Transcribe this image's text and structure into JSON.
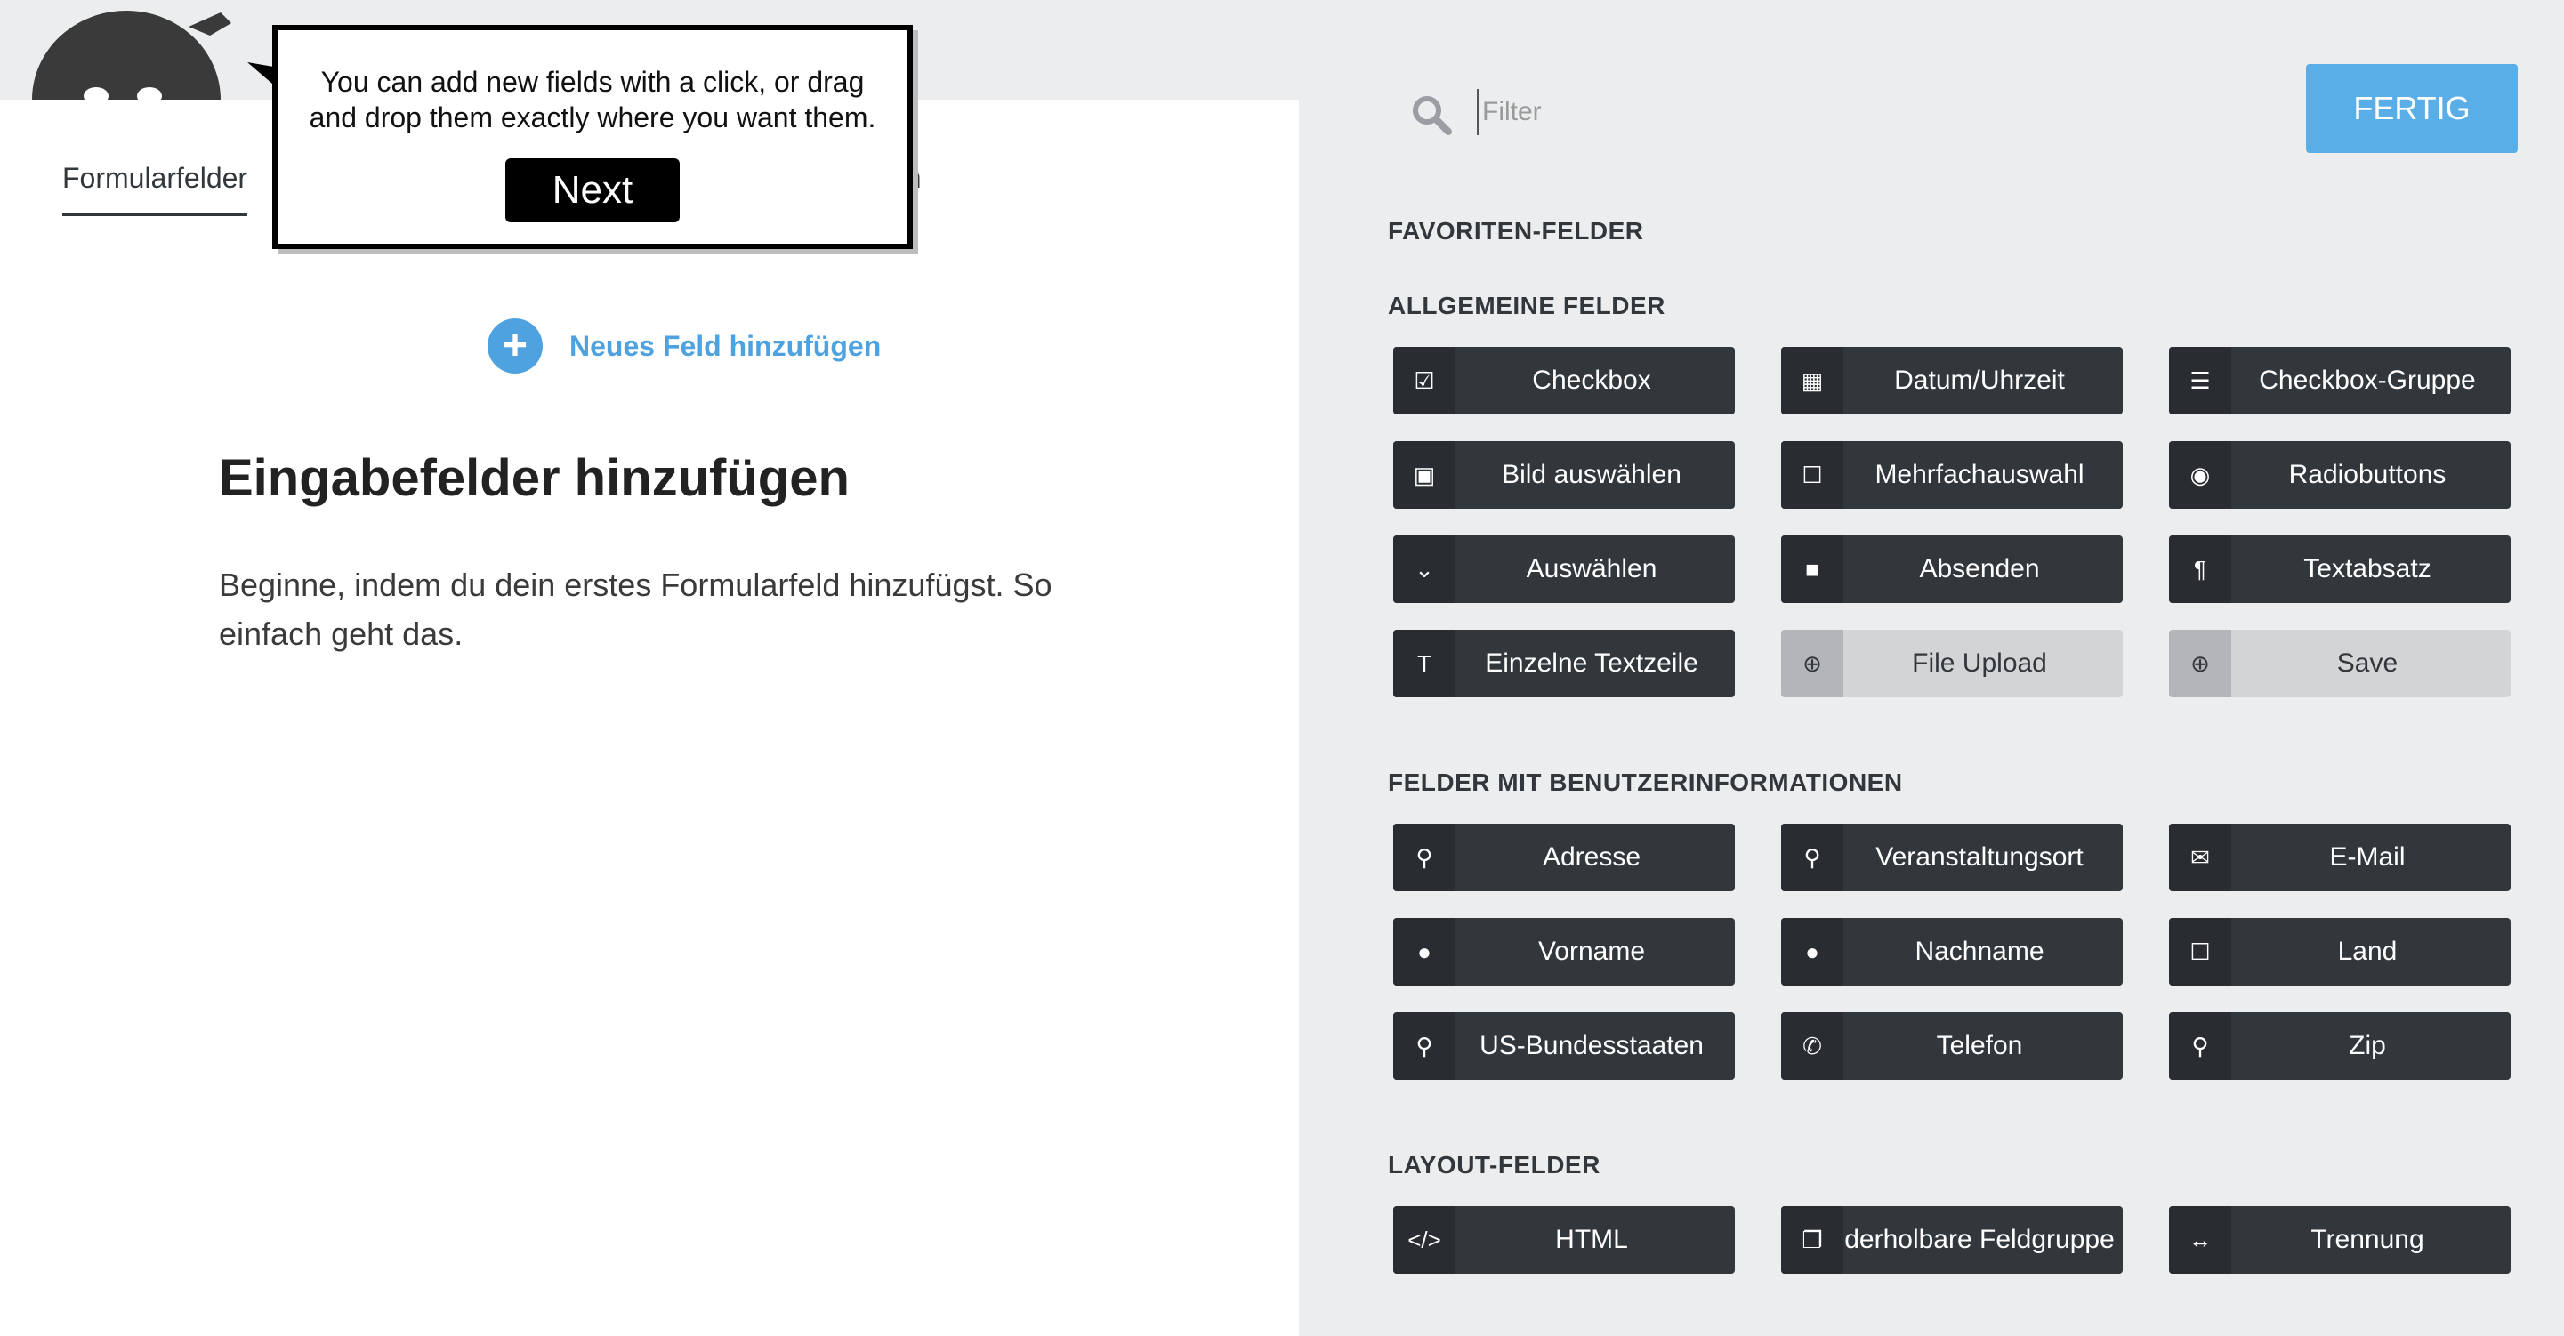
{
  "header": {
    "tabs": [
      {
        "label": "Formularfelder",
        "active": true
      },
      {
        "label": "en",
        "active": false
      }
    ]
  },
  "builder": {
    "add_field_label": "Neues Feld hinzufügen",
    "empty_title": "Eingabefelder hinzufügen",
    "empty_text": "Beginne, indem du dein erstes Formularfeld hinzufügst. So einfach geht das."
  },
  "tooltip": {
    "text": "You can add new fields with a click, or drag and drop them exactly where you want them.",
    "next_label": "Next"
  },
  "sidebar": {
    "filter_placeholder": "Filter",
    "done_label": "FERTIG",
    "sections": [
      {
        "title": "FAVORITEN-FELDER",
        "fields": []
      },
      {
        "title": "ALLGEMEINE FELDER",
        "fields": [
          {
            "label": "Checkbox",
            "icon": "check-square-icon",
            "enabled": true
          },
          {
            "label": "Datum/Uhrzeit",
            "icon": "calendar-icon",
            "enabled": true
          },
          {
            "label": "Checkbox-Gruppe",
            "icon": "list-icon",
            "enabled": true
          },
          {
            "label": "Bild auswählen",
            "icon": "image-icon",
            "enabled": true
          },
          {
            "label": "Mehrfachauswahl",
            "icon": "square-outline-icon",
            "enabled": true
          },
          {
            "label": "Radiobuttons",
            "icon": "radio-icon",
            "enabled": true
          },
          {
            "label": "Auswählen",
            "icon": "chevron-down-icon",
            "enabled": true
          },
          {
            "label": "Absenden",
            "icon": "square-filled-icon",
            "enabled": true
          },
          {
            "label": "Textabsatz",
            "icon": "paragraph-icon",
            "enabled": true
          },
          {
            "label": "Einzelne Textzeile",
            "icon": "text-icon",
            "enabled": true
          },
          {
            "label": "File Upload",
            "icon": "download-circle-icon",
            "enabled": false
          },
          {
            "label": "Save",
            "icon": "download-circle-icon",
            "enabled": false
          }
        ]
      },
      {
        "title": "FELDER MIT BENUTZERINFORMATIONEN",
        "fields": [
          {
            "label": "Adresse",
            "icon": "map-marker-icon",
            "enabled": true
          },
          {
            "label": "Veranstaltungsort",
            "icon": "map-marker-icon",
            "enabled": true
          },
          {
            "label": "E-Mail",
            "icon": "envelope-icon",
            "enabled": true
          },
          {
            "label": "Vorname",
            "icon": "user-icon",
            "enabled": true
          },
          {
            "label": "Nachname",
            "icon": "user-icon",
            "enabled": true
          },
          {
            "label": "Land",
            "icon": "square-outline-icon",
            "enabled": true
          },
          {
            "label": "US-Bundesstaaten",
            "icon": "map-marker-icon",
            "enabled": true
          },
          {
            "label": "Telefon",
            "icon": "phone-icon",
            "enabled": true
          },
          {
            "label": "Zip",
            "icon": "map-marker-icon",
            "enabled": true
          }
        ]
      },
      {
        "title": "LAYOUT-FELDER",
        "fields": [
          {
            "label": "HTML",
            "icon": "code-icon",
            "enabled": true
          },
          {
            "label": "derholbare Feldgruppe",
            "icon": "copy-icon",
            "enabled": true
          },
          {
            "label": "Trennung",
            "icon": "arrows-h-icon",
            "enabled": true
          }
        ]
      }
    ]
  },
  "colors": {
    "accent": "#4fa2e0",
    "done_button": "#5aaee8",
    "field_button": "#32373c",
    "field_button_disabled": "#d3d4d6",
    "panel_bg": "#ecedef"
  }
}
